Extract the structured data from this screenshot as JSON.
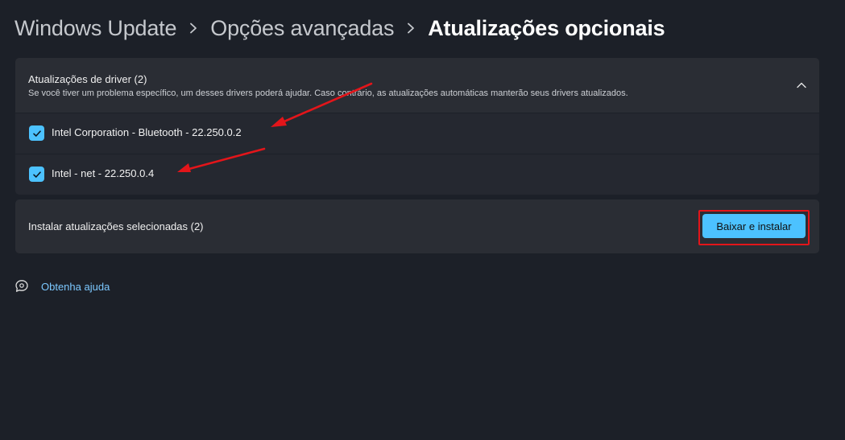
{
  "breadcrumb": {
    "items": [
      "Windows Update",
      "Opções avançadas"
    ],
    "current": "Atualizações opcionais"
  },
  "driver_section": {
    "title": "Atualizações de driver (2)",
    "description": "Se você tiver um problema específico, um desses drivers poderá ajudar. Caso contrário, as atualizações automáticas manterão seus drivers atualizados.",
    "expanded": true,
    "drivers": [
      {
        "label": "Intel Corporation - Bluetooth - 22.250.0.2",
        "checked": true
      },
      {
        "label": "Intel - net - 22.250.0.4",
        "checked": true
      }
    ]
  },
  "install": {
    "label": "Instalar atualizações selecionadas (2)",
    "button_label": "Baixar e instalar"
  },
  "help": {
    "link_label": "Obtenha ajuda"
  },
  "colors": {
    "background": "#1c2028",
    "card": "#2a2d34",
    "accent": "#4cc2ff",
    "annotation_red": "#e3151a",
    "link": "#7cc8ff"
  }
}
